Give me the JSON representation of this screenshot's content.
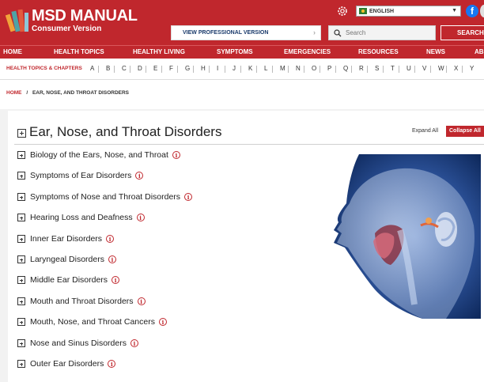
{
  "header": {
    "brand_title": "MSD MANUAL",
    "brand_subtitle": "Consumer Version",
    "language": "ENGLISH",
    "professional_link": "VIEW PROFESSIONAL VERSION",
    "search_placeholder": "Search",
    "search_button": "SEARCH",
    "social_icon": "f",
    "accent_color": "#c0272d"
  },
  "nav": {
    "items": [
      "HOME",
      "HEALTH TOPICS",
      "HEALTHY LIVING",
      "SYMPTOMS",
      "EMERGENCIES",
      "RESOURCES",
      "NEWS",
      "AB"
    ]
  },
  "alphabet": {
    "label": "HEALTH TOPICS & CHAPTERS",
    "letters": [
      "A",
      "B",
      "C",
      "D",
      "E",
      "F",
      "G",
      "H",
      "I",
      "J",
      "K",
      "L",
      "M",
      "N",
      "O",
      "P",
      "Q",
      "R",
      "S",
      "T",
      "U",
      "V",
      "W",
      "X",
      "Y"
    ]
  },
  "breadcrumb": {
    "home": "HOME",
    "separator": "/",
    "current": "EAR, NOSE, AND THROAT DISORDERS"
  },
  "main": {
    "title": "Ear, Nose, and Throat Disorders",
    "expand_all": "Expand All",
    "collapse_all": "Collapse All",
    "info_glyph": "i",
    "topics": [
      "Biology of the Ears, Nose, and Throat",
      "Symptoms of Ear Disorders",
      "Symptoms of Nose and Throat Disorders",
      "Hearing Loss and Deafness",
      "Inner Ear Disorders",
      "Laryngeal Disorders",
      "Middle Ear Disorders",
      "Mouth and Throat Disorders",
      "Mouth, Nose, and Throat Cancers",
      "Nose and Sinus Disorders",
      "Outer Ear Disorders"
    ]
  }
}
